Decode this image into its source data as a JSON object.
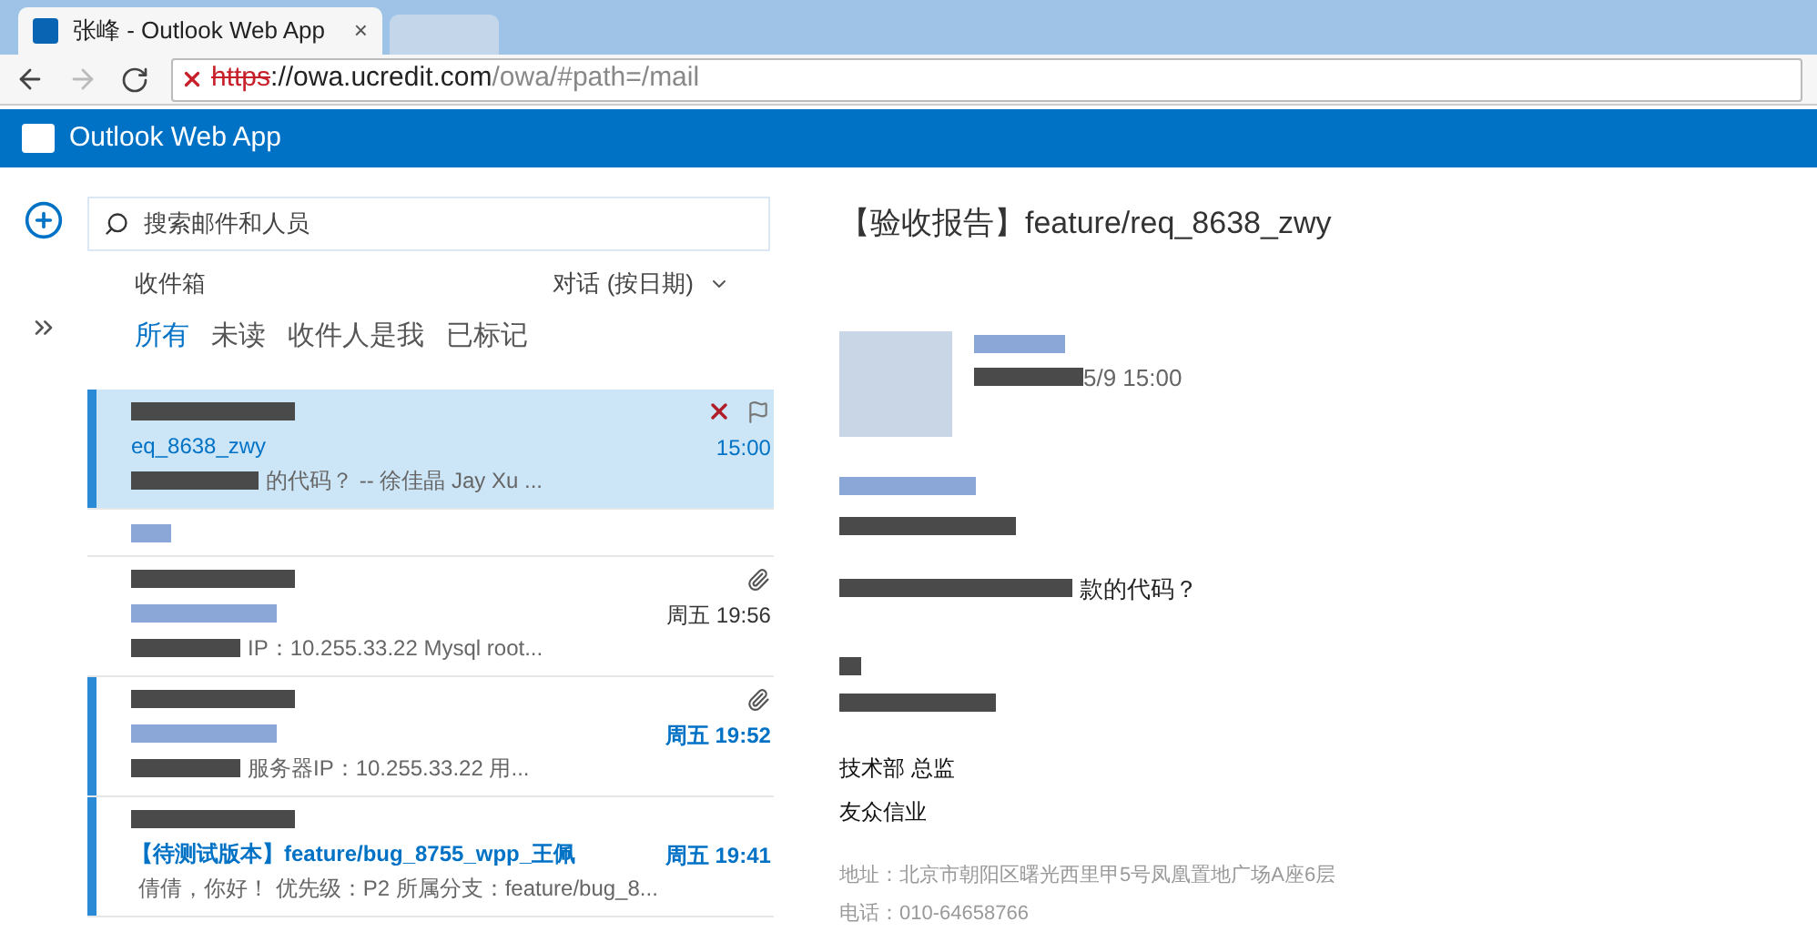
{
  "browser": {
    "tab_title": "张峰 - Outlook Web App",
    "tab_close": "×",
    "url_scheme": "https",
    "url_host": "://owa.ucredit.com",
    "url_path": "/owa/#path=/mail"
  },
  "app": {
    "title": "Outlook Web App"
  },
  "search": {
    "placeholder": "搜索邮件和人员"
  },
  "folder": "收件箱",
  "sort": "对话 (按日期)",
  "filters": [
    {
      "label": "所有",
      "selected": true
    },
    {
      "label": "未读",
      "selected": false
    },
    {
      "label": "收件人是我",
      "selected": false
    },
    {
      "label": "已标记",
      "selected": false
    }
  ],
  "messages": [
    {
      "subject": "eq_8638_zwy",
      "preview": "的代码？ -- 徐佳晶 Jay Xu ...",
      "time": "15:00",
      "selected": true,
      "unread": false,
      "attachment": false,
      "actions": true
    },
    {
      "kind": "group"
    },
    {
      "preview": "IP：10.255.33.22 Mysql root...",
      "time": "周五 19:56",
      "selected": false,
      "unread": false,
      "attachment": true,
      "actions": false
    },
    {
      "preview": "服务器IP：10.255.33.22 用...",
      "time": "周五 19:52",
      "selected": false,
      "unread": true,
      "attachment": true,
      "actions": false
    },
    {
      "subject": "【待测试版本】feature/bug_8755_wpp_王佩",
      "preview": "倩倩，你好！ 优先级：P2 所属分支：feature/bug_8...",
      "time": "周五 19:41",
      "selected": false,
      "unread": true,
      "attachment": false,
      "actions": false
    }
  ],
  "reading": {
    "subject": "【验收报告】feature/req_8638_zwy",
    "date": "5/9 15:00",
    "body": "款的代码？",
    "signature": [
      "技术部 总监",
      "友众信业"
    ],
    "footer": [
      "地址：北京市朝阳区曙光西里甲5号凤凰置地广场A座6层",
      "电话：010-64658766"
    ]
  }
}
